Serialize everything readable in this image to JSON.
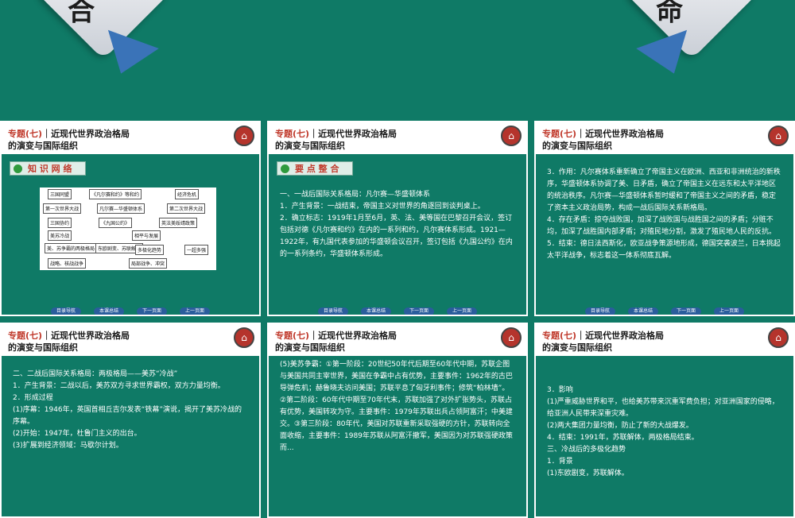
{
  "banner": {
    "left_glyph": "合",
    "right_glyph": "命"
  },
  "slides": [
    {
      "title_prefix": "专题(七)",
      "title_rest": "近现代世界政治格局",
      "subtitle": "的演变与国际组织",
      "tag": "知 识 网 络",
      "diagram": {
        "boxes": [
          "三国同盟",
          "《凡尔赛和约》等和约",
          "经济危机",
          "第一次世界大战",
          "凡尔赛—华盛顿体系",
          "第二次世界大战",
          "三国协约",
          "《九国公约》",
          "英法美绥靖政策",
          "美苏冷战",
          "相平与发展",
          "美、苏争霸的两极格局",
          "东欧剧变、苏联解体",
          "多极化趋势",
          "一超多强",
          "局部战争、冲突",
          "战略、核战战争"
        ]
      },
      "nav": [
        "目录导航",
        "本课总结",
        "下一页面",
        "上一页面"
      ]
    },
    {
      "title_prefix": "专题(七)",
      "title_rest": "近现代世界政治格局",
      "subtitle": "的演变与国际组织",
      "tag": "要 点 整 合",
      "paragraphs": [
        "一、一战后国际关系格局：凡尔赛—华盛顿体系",
        "1．产生背景：一战结束，帝国主义对世界的角逐回到谈判桌上。",
        "2．确立标志：1919年1月至6月，英、法、美等国在巴黎召开会议，签订包括对德《凡尔赛和约》在内的一系列和约，凡尔赛体系形成。1921—1922年，有九国代表参加的华盛顿会议召开，签订包括《九国公约》在内的一系列条约，华盛顿体系形成。"
      ],
      "nav": [
        "目录导航",
        "本课总结",
        "下一页面",
        "上一页面"
      ]
    },
    {
      "title_prefix": "专题(七)",
      "title_rest": "近现代世界政治格局",
      "subtitle": "的演变与国际组织",
      "paragraphs": [
        "3．作用：凡尔赛体系重新确立了帝国主义在欧洲、西亚和非洲统治的新秩序，华盛顿体系协调了美、日矛盾，确立了帝国主义在远东和太平洋地区的统治秩序。凡尔赛—华盛顿体系暂时缓和了帝国主义之间的矛盾，稳定了资本主义政治局势，构成一战后国际关系新格局。",
        "4．存在矛盾：掠夺战败国，加深了战败国与战胜国之间的矛盾；分赃不均，加深了战胜国内部矛盾；对殖民地分割，激发了殖民地人民的反抗。",
        "5．结束：德日法西斯化，欧亚战争策源地形成，德国突袭波兰，日本挑起太平洋战争，标志着这一体系彻底瓦解。"
      ],
      "nav": [
        "目录导航",
        "本课总结",
        "下一页面",
        "上一页面"
      ]
    },
    {
      "title_prefix": "专题(七)",
      "title_rest": "近现代世界政治格局",
      "subtitle": "的演变与国际组织",
      "paragraphs": [
        "二、二战后国际关系格局：两极格局——美苏“冷战”",
        "1．产生背景：二战以后，美苏双方寻求世界霸权，双方力量均衡。",
        "2．形成过程",
        "(1)序幕：1946年，英国首相丘吉尔发表“铁幕”演说，揭开了美苏冷战的序幕。",
        "(2)开始：1947年，杜鲁门主义的出台。",
        "(3)扩展到经济领域：马歇尔计划。"
      ]
    },
    {
      "title_prefix": "专题(七)",
      "title_rest": "近现代世界政治格局",
      "subtitle": "的演变与国际组织",
      "paragraphs": [
        "(5)美苏争霸：①第一阶段：20世纪50年代后期至60年代中期，苏联企图与美国共同主宰世界，美国在争霸中占有优势，主要事件：1962年的古巴导弹危机；赫鲁晓夫访问美国；苏联平息了匈牙利事件；修筑“柏林墙”。②第二阶段：60年代中期至70年代末，苏联加强了对外扩张势头，苏联占有优势，美国转攻为守。主要事件：1979年苏联出兵占领阿富汗；中美建交。③第三阶段：80年代，美国对苏联重新采取强硬的方针，苏联转向全面收缩，主要事件：1989年苏联从阿富汗撤军，美国因为对苏联强硬政策而..."
      ]
    },
    {
      "title_prefix": "专题(七)",
      "title_rest": "近现代世界政治格局",
      "subtitle": "的演变与国际组织",
      "paragraphs": [
        "3．影响",
        "(1)严重威胁世界和平，也给美苏带来沉重军费负担；对亚洲国家的侵略，给亚洲人民带来深重灾难。",
        "(2)两大集团力量均衡，防止了新的大战爆发。",
        "4．结束：1991年，苏联解体，两极格局结束。",
        "三、冷战后的多极化趋势",
        "1．背景",
        "(1)东欧剧变，苏联解体。"
      ]
    }
  ]
}
